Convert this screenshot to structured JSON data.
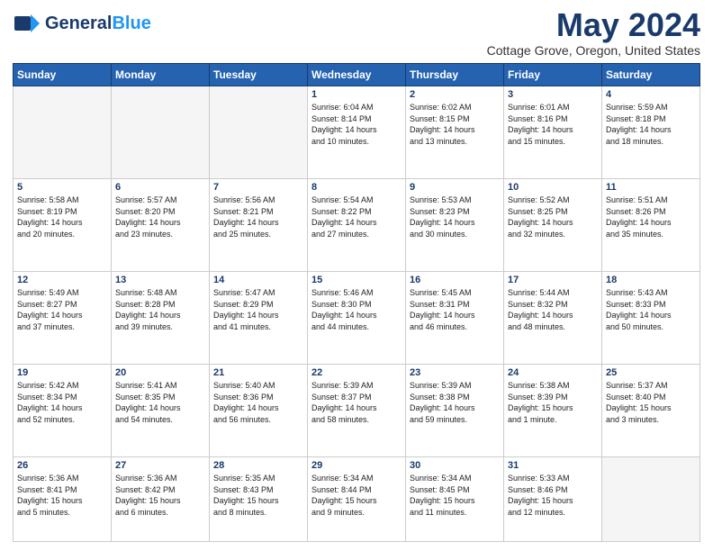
{
  "header": {
    "logo_general": "General",
    "logo_blue": "Blue",
    "month": "May 2024",
    "location": "Cottage Grove, Oregon, United States"
  },
  "weekdays": [
    "Sunday",
    "Monday",
    "Tuesday",
    "Wednesday",
    "Thursday",
    "Friday",
    "Saturday"
  ],
  "weeks": [
    [
      {
        "day": "",
        "info": ""
      },
      {
        "day": "",
        "info": ""
      },
      {
        "day": "",
        "info": ""
      },
      {
        "day": "1",
        "info": "Sunrise: 6:04 AM\nSunset: 8:14 PM\nDaylight: 14 hours\nand 10 minutes."
      },
      {
        "day": "2",
        "info": "Sunrise: 6:02 AM\nSunset: 8:15 PM\nDaylight: 14 hours\nand 13 minutes."
      },
      {
        "day": "3",
        "info": "Sunrise: 6:01 AM\nSunset: 8:16 PM\nDaylight: 14 hours\nand 15 minutes."
      },
      {
        "day": "4",
        "info": "Sunrise: 5:59 AM\nSunset: 8:18 PM\nDaylight: 14 hours\nand 18 minutes."
      }
    ],
    [
      {
        "day": "5",
        "info": "Sunrise: 5:58 AM\nSunset: 8:19 PM\nDaylight: 14 hours\nand 20 minutes."
      },
      {
        "day": "6",
        "info": "Sunrise: 5:57 AM\nSunset: 8:20 PM\nDaylight: 14 hours\nand 23 minutes."
      },
      {
        "day": "7",
        "info": "Sunrise: 5:56 AM\nSunset: 8:21 PM\nDaylight: 14 hours\nand 25 minutes."
      },
      {
        "day": "8",
        "info": "Sunrise: 5:54 AM\nSunset: 8:22 PM\nDaylight: 14 hours\nand 27 minutes."
      },
      {
        "day": "9",
        "info": "Sunrise: 5:53 AM\nSunset: 8:23 PM\nDaylight: 14 hours\nand 30 minutes."
      },
      {
        "day": "10",
        "info": "Sunrise: 5:52 AM\nSunset: 8:25 PM\nDaylight: 14 hours\nand 32 minutes."
      },
      {
        "day": "11",
        "info": "Sunrise: 5:51 AM\nSunset: 8:26 PM\nDaylight: 14 hours\nand 35 minutes."
      }
    ],
    [
      {
        "day": "12",
        "info": "Sunrise: 5:49 AM\nSunset: 8:27 PM\nDaylight: 14 hours\nand 37 minutes."
      },
      {
        "day": "13",
        "info": "Sunrise: 5:48 AM\nSunset: 8:28 PM\nDaylight: 14 hours\nand 39 minutes."
      },
      {
        "day": "14",
        "info": "Sunrise: 5:47 AM\nSunset: 8:29 PM\nDaylight: 14 hours\nand 41 minutes."
      },
      {
        "day": "15",
        "info": "Sunrise: 5:46 AM\nSunset: 8:30 PM\nDaylight: 14 hours\nand 44 minutes."
      },
      {
        "day": "16",
        "info": "Sunrise: 5:45 AM\nSunset: 8:31 PM\nDaylight: 14 hours\nand 46 minutes."
      },
      {
        "day": "17",
        "info": "Sunrise: 5:44 AM\nSunset: 8:32 PM\nDaylight: 14 hours\nand 48 minutes."
      },
      {
        "day": "18",
        "info": "Sunrise: 5:43 AM\nSunset: 8:33 PM\nDaylight: 14 hours\nand 50 minutes."
      }
    ],
    [
      {
        "day": "19",
        "info": "Sunrise: 5:42 AM\nSunset: 8:34 PM\nDaylight: 14 hours\nand 52 minutes."
      },
      {
        "day": "20",
        "info": "Sunrise: 5:41 AM\nSunset: 8:35 PM\nDaylight: 14 hours\nand 54 minutes."
      },
      {
        "day": "21",
        "info": "Sunrise: 5:40 AM\nSunset: 8:36 PM\nDaylight: 14 hours\nand 56 minutes."
      },
      {
        "day": "22",
        "info": "Sunrise: 5:39 AM\nSunset: 8:37 PM\nDaylight: 14 hours\nand 58 minutes."
      },
      {
        "day": "23",
        "info": "Sunrise: 5:39 AM\nSunset: 8:38 PM\nDaylight: 14 hours\nand 59 minutes."
      },
      {
        "day": "24",
        "info": "Sunrise: 5:38 AM\nSunset: 8:39 PM\nDaylight: 15 hours\nand 1 minute."
      },
      {
        "day": "25",
        "info": "Sunrise: 5:37 AM\nSunset: 8:40 PM\nDaylight: 15 hours\nand 3 minutes."
      }
    ],
    [
      {
        "day": "26",
        "info": "Sunrise: 5:36 AM\nSunset: 8:41 PM\nDaylight: 15 hours\nand 5 minutes."
      },
      {
        "day": "27",
        "info": "Sunrise: 5:36 AM\nSunset: 8:42 PM\nDaylight: 15 hours\nand 6 minutes."
      },
      {
        "day": "28",
        "info": "Sunrise: 5:35 AM\nSunset: 8:43 PM\nDaylight: 15 hours\nand 8 minutes."
      },
      {
        "day": "29",
        "info": "Sunrise: 5:34 AM\nSunset: 8:44 PM\nDaylight: 15 hours\nand 9 minutes."
      },
      {
        "day": "30",
        "info": "Sunrise: 5:34 AM\nSunset: 8:45 PM\nDaylight: 15 hours\nand 11 minutes."
      },
      {
        "day": "31",
        "info": "Sunrise: 5:33 AM\nSunset: 8:46 PM\nDaylight: 15 hours\nand 12 minutes."
      },
      {
        "day": "",
        "info": ""
      }
    ]
  ]
}
